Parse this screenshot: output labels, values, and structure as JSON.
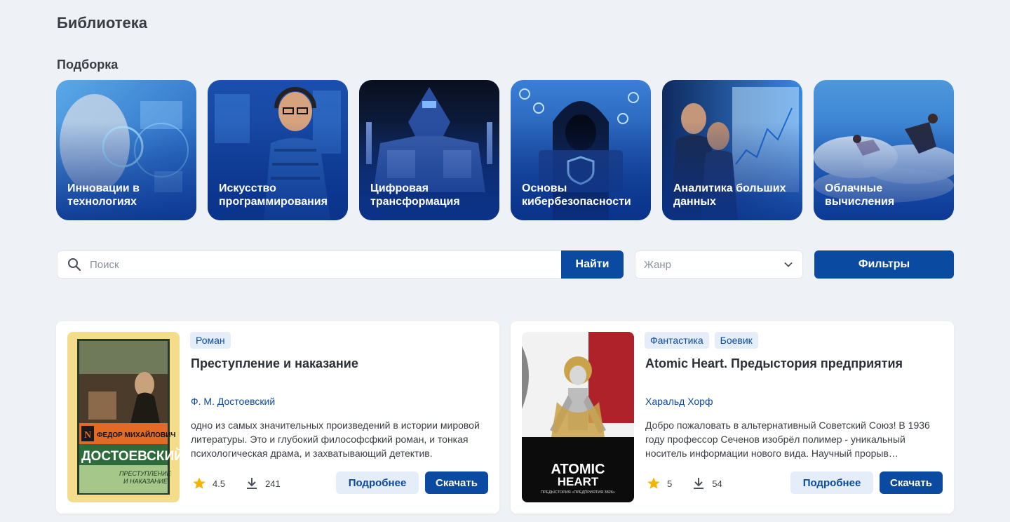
{
  "header": {
    "title": "Библиотека"
  },
  "collections": {
    "title": "Подборка",
    "items": [
      {
        "label": "Инновации в\nтехнологиях",
        "image": "robot-face-icon"
      },
      {
        "label": "Искусство\nпрограммирования",
        "image": "programmer-headphones-icon"
      },
      {
        "label": "Цифровая\nтрансформация",
        "image": "robot-mech-icon"
      },
      {
        "label": "Основы\nкибербезопасности",
        "image": "hooded-hacker-icon"
      },
      {
        "label": "Аналитика больших\nданных",
        "image": "analysts-screen-icon"
      },
      {
        "label": "Облачные\nвычисления",
        "image": "clouds-people-icon"
      }
    ]
  },
  "search": {
    "placeholder": "Поиск",
    "value": "",
    "button": "Найти"
  },
  "genre": {
    "placeholder": "Жанр"
  },
  "filters": {
    "label": "Фильтры"
  },
  "books": [
    {
      "tags": [
        "Роман"
      ],
      "title": "Преступление и наказание",
      "author": "Ф. М.  Достоевский",
      "description": "одно из самых значительных произведений в истории мировой литературы. Это и глубокий философсфкий роман, и тонкая психологическая драма, и захватывающий детектив.",
      "rating": "4.5",
      "downloads": "241",
      "more_label": "Подробнее",
      "download_label": "Скачать",
      "cover": {
        "author_line": "ФЕДОР МИХАЙЛОВИЧ",
        "author_big": "ДОСТОЕВСКИЙ",
        "title_line1": "ПРЕСТУПЛЕНИЕ",
        "title_line2": "И НАКАЗАНИЕ"
      }
    },
    {
      "tags": [
        "Фантастика",
        "Боевик"
      ],
      "title": "Atomic Heart. Предыстория предприятия",
      "author": "Харальд Хорф",
      "description": "Добро пожаловать в альтернативный Советский Союз! В 1936 году профессор Сеченов изобрёл полимер - уникальный носитель информации нового вида. Научный прорыв…",
      "rating": "5",
      "downloads": "54",
      "more_label": "Подробнее",
      "download_label": "Скачать",
      "cover": {
        "logo_line1": "ATOMIC",
        "logo_line2": "HEART",
        "subtitle": "ПРЕДЫСТОРИЯ «ПРЕДПРИЯТИЯ 3826»"
      }
    }
  ],
  "colors": {
    "accent": "#0a4aa0",
    "background": "#eef1f5",
    "tag_bg": "#e5eef8",
    "star": "#f5b400"
  }
}
